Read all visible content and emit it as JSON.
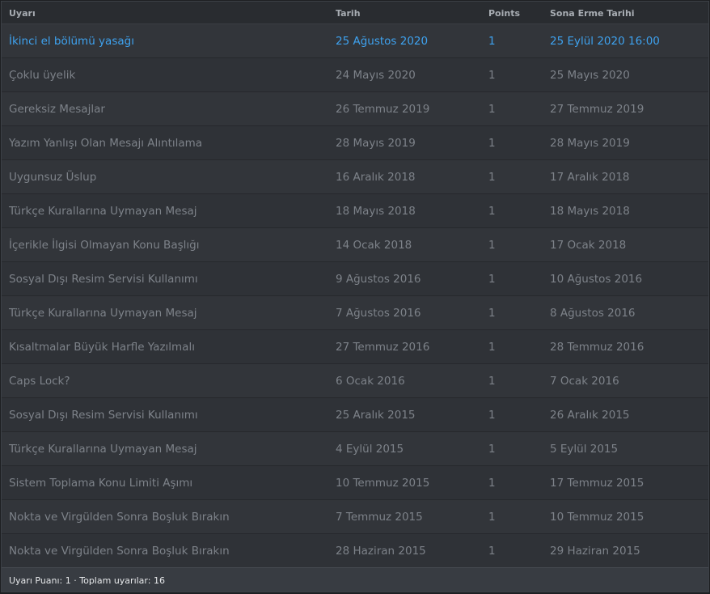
{
  "table": {
    "headers": {
      "warning": "Uyarı",
      "date": "Tarih",
      "points": "Points",
      "expiry": "Sona Erme Tarihi"
    },
    "rows": [
      {
        "warning": "İkinci el bölümü yasağı",
        "date": "25 Ağustos 2020",
        "points": "1",
        "expiry": "25 Eylül 2020 16:00",
        "active": true
      },
      {
        "warning": "Çoklu üyelik",
        "date": "24 Mayıs 2020",
        "points": "1",
        "expiry": "25 Mayıs 2020",
        "active": false
      },
      {
        "warning": "Gereksiz Mesajlar",
        "date": "26 Temmuz 2019",
        "points": "1",
        "expiry": "27 Temmuz 2019",
        "active": false
      },
      {
        "warning": "Yazım Yanlışı Olan Mesajı Alıntılama",
        "date": "28 Mayıs 2019",
        "points": "1",
        "expiry": "28 Mayıs 2019",
        "active": false
      },
      {
        "warning": "Uygunsuz Üslup",
        "date": "16 Aralık 2018",
        "points": "1",
        "expiry": "17 Aralık 2018",
        "active": false
      },
      {
        "warning": "Türkçe Kurallarına Uymayan Mesaj",
        "date": "18 Mayıs 2018",
        "points": "1",
        "expiry": "18 Mayıs 2018",
        "active": false
      },
      {
        "warning": "İçerikle İlgisi Olmayan Konu Başlığı",
        "date": "14 Ocak 2018",
        "points": "1",
        "expiry": "17 Ocak 2018",
        "active": false
      },
      {
        "warning": "Sosyal Dışı Resim Servisi Kullanımı",
        "date": "9 Ağustos 2016",
        "points": "1",
        "expiry": "10 Ağustos 2016",
        "active": false
      },
      {
        "warning": "Türkçe Kurallarına Uymayan Mesaj",
        "date": "7 Ağustos 2016",
        "points": "1",
        "expiry": "8 Ağustos 2016",
        "active": false
      },
      {
        "warning": "Kısaltmalar Büyük Harfle Yazılmalı",
        "date": "27 Temmuz 2016",
        "points": "1",
        "expiry": "28 Temmuz 2016",
        "active": false
      },
      {
        "warning": "Caps Lock?",
        "date": "6 Ocak 2016",
        "points": "1",
        "expiry": "7 Ocak 2016",
        "active": false
      },
      {
        "warning": "Sosyal Dışı Resim Servisi Kullanımı",
        "date": "25 Aralık 2015",
        "points": "1",
        "expiry": "26 Aralık 2015",
        "active": false
      },
      {
        "warning": "Türkçe Kurallarına Uymayan Mesaj",
        "date": "4 Eylül 2015",
        "points": "1",
        "expiry": "5 Eylül 2015",
        "active": false
      },
      {
        "warning": "Sistem Toplama Konu Limiti Aşımı",
        "date": "10 Temmuz 2015",
        "points": "1",
        "expiry": "17 Temmuz 2015",
        "active": false
      },
      {
        "warning": "Nokta ve Virgülden Sonra Boşluk Bırakın",
        "date": "7 Temmuz 2015",
        "points": "1",
        "expiry": "10 Temmuz 2015",
        "active": false
      },
      {
        "warning": "Nokta ve Virgülden Sonra Boşluk Bırakın",
        "date": "28 Haziran 2015",
        "points": "1",
        "expiry": "29 Haziran 2015",
        "active": false
      }
    ]
  },
  "footer": {
    "summary": "Uyarı Puanı: 1 · Toplam uyarılar: 16"
  },
  "colors": {
    "active_text": "#3ea2ef",
    "row_text": "#7d8289",
    "header_text": "#a8adb3"
  }
}
